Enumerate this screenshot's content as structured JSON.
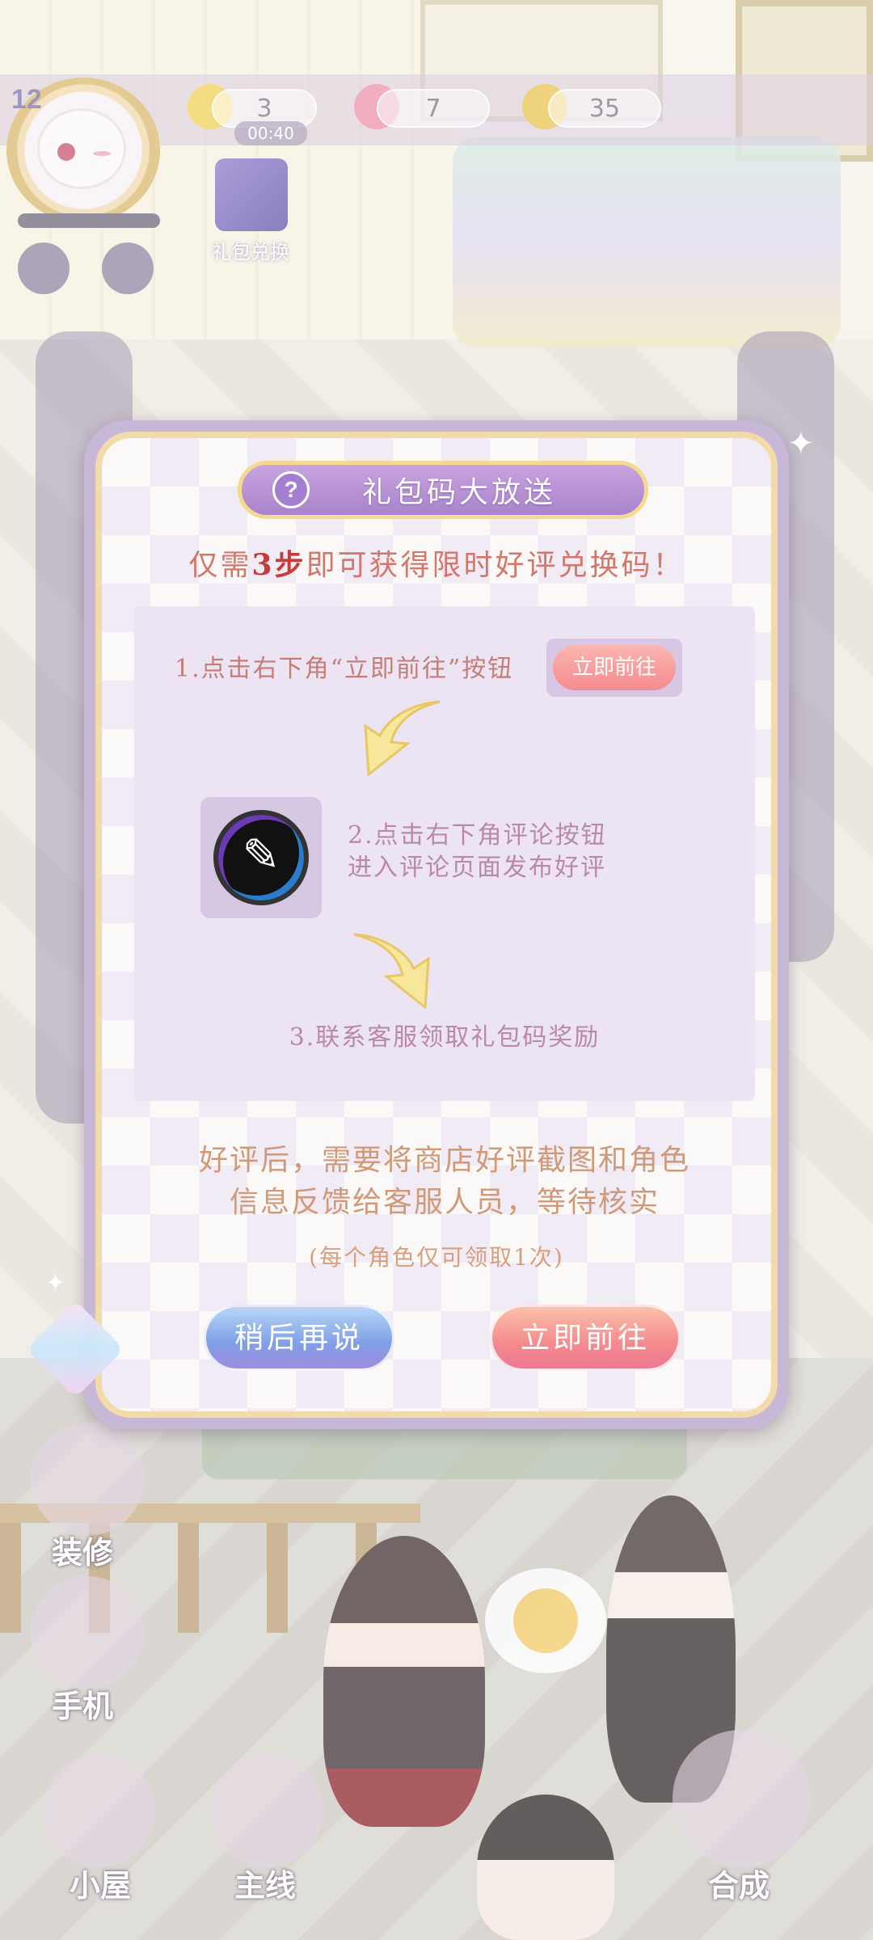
{
  "hud": {
    "level": "12",
    "energy": "3",
    "energy_timer": "00:40",
    "gems": "7",
    "coins": "35",
    "gift_redeem_label": "礼包兑换"
  },
  "bottom_nav": {
    "decorate": "装修",
    "phone": "手机",
    "house": "小屋",
    "main_story": "主线",
    "merge": "合成"
  },
  "dialog": {
    "title": "礼包码大放送",
    "subtitle_pre": "仅需",
    "subtitle_num": "3步",
    "subtitle_post": "即可获得限时好评兑换码！",
    "step1": "1.点击右下角“立即前往”按钮",
    "step1_button": "立即前往",
    "step2_line1": "2.点击右下角评论按钮",
    "step2_line2": "进入评论页面发布好评",
    "step3": "3.联系客服领取礼包码奖励",
    "note_line1": "好评后，需要将商店好评截图和角色",
    "note_line2": "信息反馈给客服人员，等待核实",
    "note_small": "(每个角色仅可领取1次)",
    "later_button": "稍后再说",
    "go_button": "立即前往"
  }
}
